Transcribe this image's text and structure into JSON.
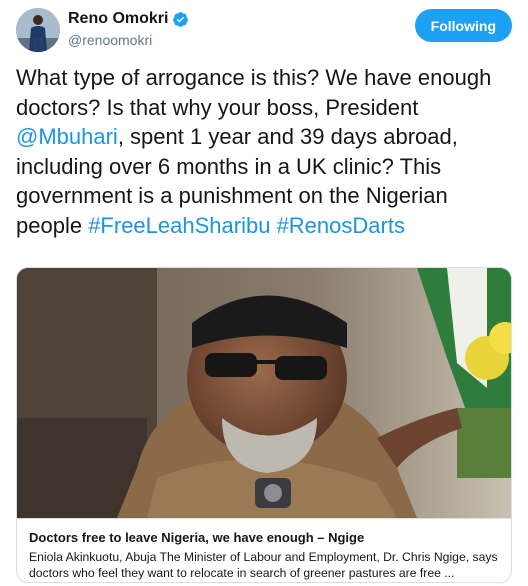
{
  "author": {
    "display_name": "Reno Omokri",
    "handle": "@renoomokri",
    "verified": true,
    "avatar_icon": "profile-photo"
  },
  "follow_button": {
    "label": "Following",
    "color": "#1da1f2"
  },
  "tweet": {
    "segments": [
      {
        "text": "What type of arrogance is this? We have enough doctors? Is that why your boss, President ",
        "link": false
      },
      {
        "text": "@Mbuhari",
        "link": true
      },
      {
        "text": ", spent 1 year and 39 days abroad, including over 6 months in a UK clinic? This government is a punishment on the Nigerian people ",
        "link": false
      },
      {
        "text": "#FreeLeahSharibu",
        "link": true
      },
      {
        "text": " ",
        "link": false
      },
      {
        "text": "#RenosDarts",
        "link": true
      }
    ],
    "link_color": "#1b95e0"
  },
  "card": {
    "title": "Doctors free to leave Nigeria, we have enough – Ngige",
    "description": "Eniola Akinkuotu, Abuja The Minister of Labour and Employment, Dr. Chris Ngige, says doctors who feel they want to relocate in search of greener pastures are free ..."
  }
}
